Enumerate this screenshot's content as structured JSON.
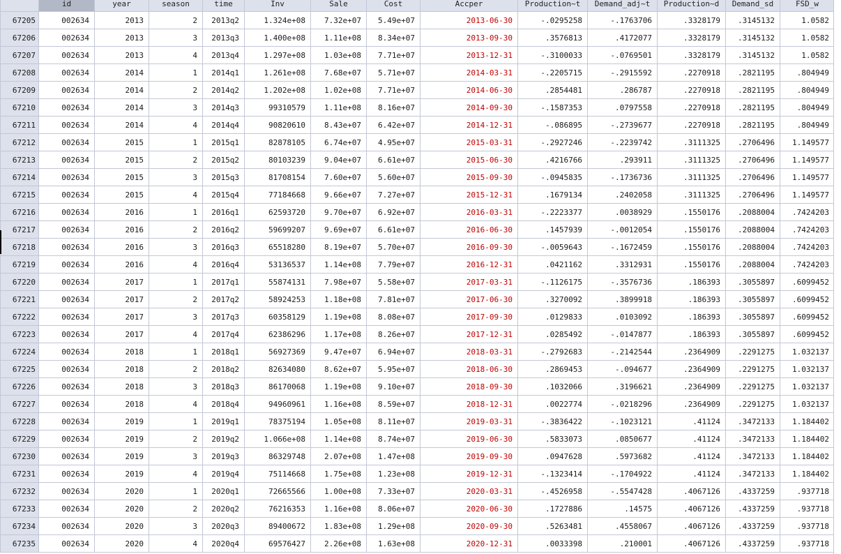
{
  "columns": [
    "",
    "id",
    "year",
    "season",
    "time",
    "Inv",
    "Sale",
    "Cost",
    "Accper",
    "Production~t",
    "Demand_adj~t",
    "Production~d",
    "Demand_sd",
    "FSD_w"
  ],
  "selected_column": "id",
  "colors": {
    "date": "#c00000",
    "header": "#dde1ec",
    "header_selected": "#b3b8c7"
  },
  "rows": [
    [
      "67205",
      "002634",
      "2013",
      "2",
      "2013q2",
      "1.324e+08",
      "7.32e+07",
      "5.49e+07",
      "2013-06-30",
      "-.0295258",
      "-.1763706",
      ".3328179",
      ".3145132",
      "1.0582"
    ],
    [
      "67206",
      "002634",
      "2013",
      "3",
      "2013q3",
      "1.400e+08",
      "1.11e+08",
      "8.34e+07",
      "2013-09-30",
      ".3576813",
      ".4172077",
      ".3328179",
      ".3145132",
      "1.0582"
    ],
    [
      "67207",
      "002634",
      "2013",
      "4",
      "2013q4",
      "1.297e+08",
      "1.03e+08",
      "7.71e+07",
      "2013-12-31",
      "-.3100033",
      "-.0769501",
      ".3328179",
      ".3145132",
      "1.0582"
    ],
    [
      "67208",
      "002634",
      "2014",
      "1",
      "2014q1",
      "1.261e+08",
      "7.68e+07",
      "5.71e+07",
      "2014-03-31",
      "-.2205715",
      "-.2915592",
      ".2270918",
      ".2821195",
      ".804949"
    ],
    [
      "67209",
      "002634",
      "2014",
      "2",
      "2014q2",
      "1.202e+08",
      "1.02e+08",
      "7.71e+07",
      "2014-06-30",
      ".2854481",
      ".286787",
      ".2270918",
      ".2821195",
      ".804949"
    ],
    [
      "67210",
      "002634",
      "2014",
      "3",
      "2014q3",
      "99310579",
      "1.11e+08",
      "8.16e+07",
      "2014-09-30",
      "-.1587353",
      ".0797558",
      ".2270918",
      ".2821195",
      ".804949"
    ],
    [
      "67211",
      "002634",
      "2014",
      "4",
      "2014q4",
      "90820610",
      "8.43e+07",
      "6.42e+07",
      "2014-12-31",
      "-.086895",
      "-.2739677",
      ".2270918",
      ".2821195",
      ".804949"
    ],
    [
      "67212",
      "002634",
      "2015",
      "1",
      "2015q1",
      "82878105",
      "6.74e+07",
      "4.95e+07",
      "2015-03-31",
      "-.2927246",
      "-.2239742",
      ".3111325",
      ".2706496",
      "1.149577"
    ],
    [
      "67213",
      "002634",
      "2015",
      "2",
      "2015q2",
      "80103239",
      "9.04e+07",
      "6.61e+07",
      "2015-06-30",
      ".4216766",
      ".293911",
      ".3111325",
      ".2706496",
      "1.149577"
    ],
    [
      "67214",
      "002634",
      "2015",
      "3",
      "2015q3",
      "81708154",
      "7.60e+07",
      "5.60e+07",
      "2015-09-30",
      "-.0945835",
      "-.1736736",
      ".3111325",
      ".2706496",
      "1.149577"
    ],
    [
      "67215",
      "002634",
      "2015",
      "4",
      "2015q4",
      "77184668",
      "9.66e+07",
      "7.27e+07",
      "2015-12-31",
      ".1679134",
      ".2402058",
      ".3111325",
      ".2706496",
      "1.149577"
    ],
    [
      "67216",
      "002634",
      "2016",
      "1",
      "2016q1",
      "62593720",
      "9.70e+07",
      "6.92e+07",
      "2016-03-31",
      "-.2223377",
      ".0038929",
      ".1550176",
      ".2088004",
      ".7424203"
    ],
    [
      "67217",
      "002634",
      "2016",
      "2",
      "2016q2",
      "59699207",
      "9.69e+07",
      "6.61e+07",
      "2016-06-30",
      ".1457939",
      "-.0012054",
      ".1550176",
      ".2088004",
      ".7424203"
    ],
    [
      "67218",
      "002634",
      "2016",
      "3",
      "2016q3",
      "65518280",
      "8.19e+07",
      "5.70e+07",
      "2016-09-30",
      "-.0059643",
      "-.1672459",
      ".1550176",
      ".2088004",
      ".7424203"
    ],
    [
      "67219",
      "002634",
      "2016",
      "4",
      "2016q4",
      "53136537",
      "1.14e+08",
      "7.79e+07",
      "2016-12-31",
      ".0421162",
      ".3312931",
      ".1550176",
      ".2088004",
      ".7424203"
    ],
    [
      "67220",
      "002634",
      "2017",
      "1",
      "2017q1",
      "55874131",
      "7.98e+07",
      "5.58e+07",
      "2017-03-31",
      "-.1126175",
      "-.3576736",
      ".186393",
      ".3055897",
      ".6099452"
    ],
    [
      "67221",
      "002634",
      "2017",
      "2",
      "2017q2",
      "58924253",
      "1.18e+08",
      "7.81e+07",
      "2017-06-30",
      ".3270092",
      ".3899918",
      ".186393",
      ".3055897",
      ".6099452"
    ],
    [
      "67222",
      "002634",
      "2017",
      "3",
      "2017q3",
      "60358129",
      "1.19e+08",
      "8.08e+07",
      "2017-09-30",
      ".0129833",
      ".0103092",
      ".186393",
      ".3055897",
      ".6099452"
    ],
    [
      "67223",
      "002634",
      "2017",
      "4",
      "2017q4",
      "62386296",
      "1.17e+08",
      "8.26e+07",
      "2017-12-31",
      ".0285492",
      "-.0147877",
      ".186393",
      ".3055897",
      ".6099452"
    ],
    [
      "67224",
      "002634",
      "2018",
      "1",
      "2018q1",
      "56927369",
      "9.47e+07",
      "6.94e+07",
      "2018-03-31",
      "-.2792683",
      "-.2142544",
      ".2364909",
      ".2291275",
      "1.032137"
    ],
    [
      "67225",
      "002634",
      "2018",
      "2",
      "2018q2",
      "82634080",
      "8.62e+07",
      "5.95e+07",
      "2018-06-30",
      ".2869453",
      "-.094677",
      ".2364909",
      ".2291275",
      "1.032137"
    ],
    [
      "67226",
      "002634",
      "2018",
      "3",
      "2018q3",
      "86170068",
      "1.19e+08",
      "9.10e+07",
      "2018-09-30",
      ".1032066",
      ".3196621",
      ".2364909",
      ".2291275",
      "1.032137"
    ],
    [
      "67227",
      "002634",
      "2018",
      "4",
      "2018q4",
      "94960961",
      "1.16e+08",
      "8.59e+07",
      "2018-12-31",
      ".0022774",
      "-.0218296",
      ".2364909",
      ".2291275",
      "1.032137"
    ],
    [
      "67228",
      "002634",
      "2019",
      "1",
      "2019q1",
      "78375194",
      "1.05e+08",
      "8.11e+07",
      "2019-03-31",
      "-.3836422",
      "-.1023121",
      ".41124",
      ".3472133",
      "1.184402"
    ],
    [
      "67229",
      "002634",
      "2019",
      "2",
      "2019q2",
      "1.066e+08",
      "1.14e+08",
      "8.74e+07",
      "2019-06-30",
      ".5833073",
      ".0850677",
      ".41124",
      ".3472133",
      "1.184402"
    ],
    [
      "67230",
      "002634",
      "2019",
      "3",
      "2019q3",
      "86329748",
      "2.07e+08",
      "1.47e+08",
      "2019-09-30",
      ".0947628",
      ".5973682",
      ".41124",
      ".3472133",
      "1.184402"
    ],
    [
      "67231",
      "002634",
      "2019",
      "4",
      "2019q4",
      "75114668",
      "1.75e+08",
      "1.23e+08",
      "2019-12-31",
      "-.1323414",
      "-.1704922",
      ".41124",
      ".3472133",
      "1.184402"
    ],
    [
      "67232",
      "002634",
      "2020",
      "1",
      "2020q1",
      "72665566",
      "1.00e+08",
      "7.33e+07",
      "2020-03-31",
      "-.4526958",
      "-.5547428",
      ".4067126",
      ".4337259",
      ".937718"
    ],
    [
      "67233",
      "002634",
      "2020",
      "2",
      "2020q2",
      "76216353",
      "1.16e+08",
      "8.06e+07",
      "2020-06-30",
      ".1727886",
      ".14575",
      ".4067126",
      ".4337259",
      ".937718"
    ],
    [
      "67234",
      "002634",
      "2020",
      "3",
      "2020q3",
      "89400672",
      "1.83e+08",
      "1.29e+08",
      "2020-09-30",
      ".5263481",
      ".4558067",
      ".4067126",
      ".4337259",
      ".937718"
    ],
    [
      "67235",
      "002634",
      "2020",
      "4",
      "2020q4",
      "69576427",
      "2.26e+08",
      "1.63e+08",
      "2020-12-31",
      ".0033398",
      ".210001",
      ".4067126",
      ".4337259",
      ".937718"
    ]
  ]
}
